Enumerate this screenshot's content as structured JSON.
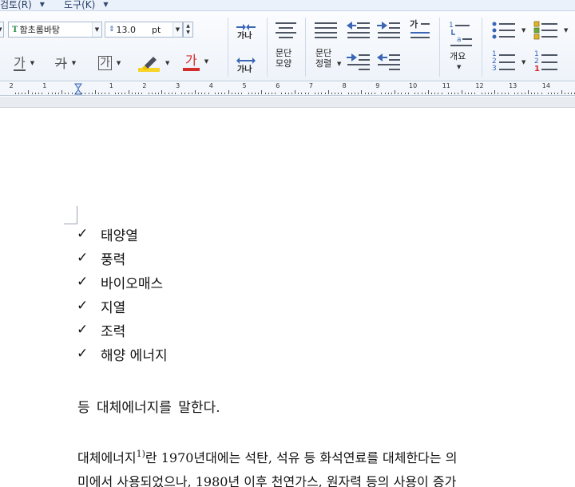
{
  "menu": {
    "review": "검토(R)",
    "tools": "도구(K)"
  },
  "ribbon": {
    "font_name": "함초롬바탕",
    "font_size": "13.0",
    "font_unit": "pt",
    "glyph_ga": "가",
    "glyph_ganada": "가나",
    "para_shape_label": "문단\n모양",
    "para_align_label": "문단\n정렬",
    "outline_label": "개요",
    "num1": "1",
    "num2": "2",
    "num3": "3",
    "letter_a": "a",
    "colors": {
      "highlight": "#f7d428",
      "font_color": "#d62b2b",
      "accent_blue": "#3a66b5"
    }
  },
  "ruler": {
    "labels": [
      "2",
      "1",
      "1",
      "2",
      "3",
      "4",
      "5",
      "6",
      "7",
      "8",
      "9",
      "10",
      "11",
      "12",
      "13",
      "14"
    ]
  },
  "document": {
    "bullet_char": "✓",
    "bullets": [
      "태양열",
      "풍력",
      "바이오매스",
      "지열",
      "조력",
      "해양 에너지"
    ],
    "para1": "등 대체에너지를 말한다.",
    "para2_pre": "대체에너지",
    "para2_sup": "1)",
    "para2_post": "란 1970년대에는 석탄, 석유 등 화석연료를 대체한다는 의",
    "para3": "미에서 사용되었으나, 1980년 이후 천연가스, 원자력 등의 사용이 증가"
  }
}
